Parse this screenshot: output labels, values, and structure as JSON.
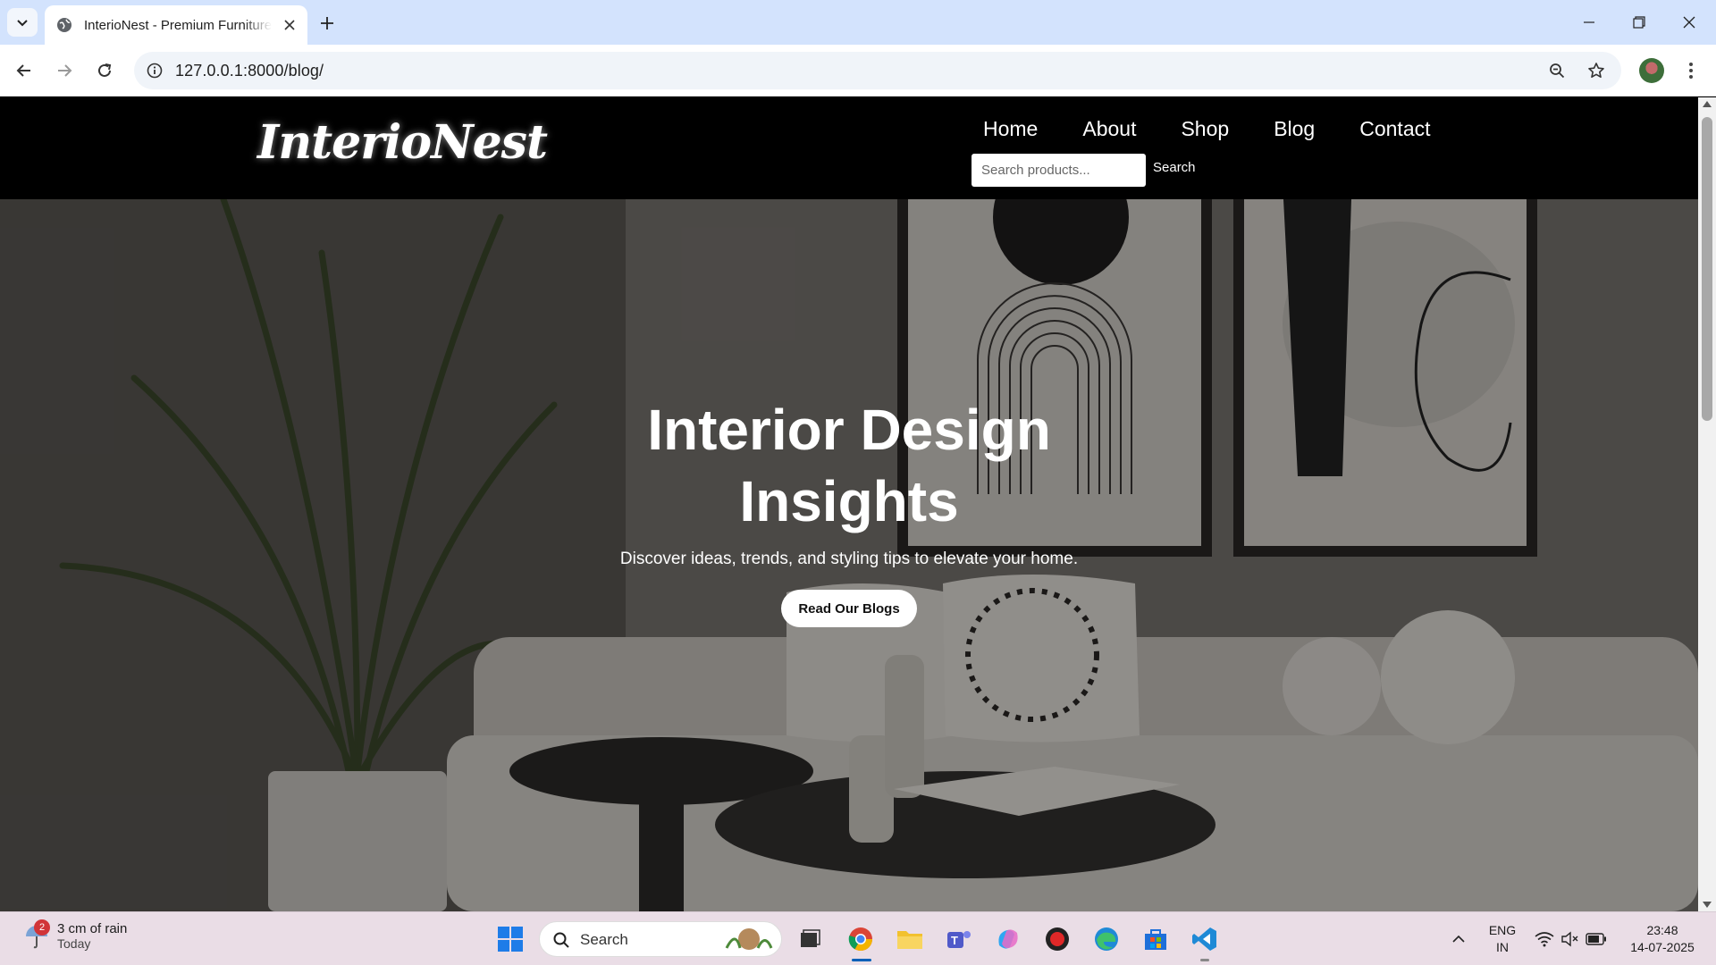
{
  "browser": {
    "tab_title": "InterioNest - Premium Furniture",
    "url": "127.0.0.1:8000/blog/"
  },
  "site": {
    "logo": "InterioNest",
    "nav": [
      "Home",
      "About",
      "Shop",
      "Blog",
      "Contact"
    ],
    "search_placeholder": "Search products...",
    "search_button": "Search"
  },
  "hero": {
    "title_line1": "Interior Design",
    "title_line2": "Insights",
    "subtitle": "Discover ideas, trends, and styling tips to elevate your home.",
    "cta": "Read Our Blogs"
  },
  "taskbar": {
    "weather_line1": "3 cm of rain",
    "weather_line2": "Today",
    "weather_badge": "2",
    "search_label": "Search",
    "lang_line1": "ENG",
    "lang_line2": "IN",
    "time": "23:48",
    "date": "14-07-2025"
  },
  "colors": {
    "tabstrip": "#d3e3fd",
    "header": "#000000",
    "taskbar": "#eadde6",
    "accent": "#005fb8"
  }
}
